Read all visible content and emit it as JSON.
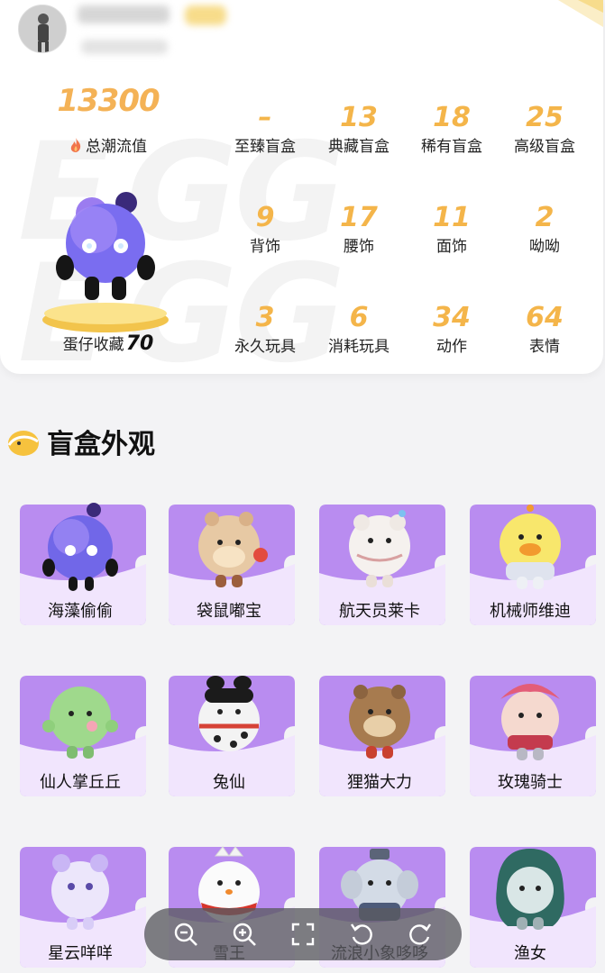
{
  "profile": {
    "total_value": "13300",
    "total_label": "总潮流值",
    "egg_label": "蛋仔收藏",
    "egg_count": "70"
  },
  "stats": [
    {
      "value": "–",
      "label": "至臻盲盒"
    },
    {
      "value": "13",
      "label": "典藏盲盒"
    },
    {
      "value": "18",
      "label": "稀有盲盒"
    },
    {
      "value": "25",
      "label": "高级盲盒"
    },
    {
      "value": "9",
      "label": "背饰"
    },
    {
      "value": "17",
      "label": "腰饰"
    },
    {
      "value": "11",
      "label": "面饰"
    },
    {
      "value": "2",
      "label": "呦呦"
    },
    {
      "value": "3",
      "label": "永久玩具"
    },
    {
      "value": "6",
      "label": "消耗玩具"
    },
    {
      "value": "34",
      "label": "动作"
    },
    {
      "value": "64",
      "label": "表情"
    }
  ],
  "section": {
    "title": "盲盒外观"
  },
  "items": [
    {
      "name": "海藻偷偷"
    },
    {
      "name": "袋鼠嘟宝"
    },
    {
      "name": "航天员莱卡"
    },
    {
      "name": "机械师维迪"
    },
    {
      "name": "仙人掌丘丘"
    },
    {
      "name": "兔仙"
    },
    {
      "name": "狸猫大力"
    },
    {
      "name": "玫瑰骑士"
    },
    {
      "name": "星云咩咩"
    },
    {
      "name": "雪王"
    },
    {
      "name": "流浪小象哆哆"
    },
    {
      "name": "渔女"
    }
  ],
  "toolbar": {
    "zoom_out": "zoom-out-icon",
    "zoom_in": "zoom-in-icon",
    "fullscreen": "fullscreen-icon",
    "rotate_left": "rotate-left-icon",
    "rotate_right": "rotate-right-icon"
  },
  "colors": {
    "stat_value": "#f4b54a",
    "tile_purple": "#b98cf0",
    "tile_light": "#f1e5fd"
  }
}
